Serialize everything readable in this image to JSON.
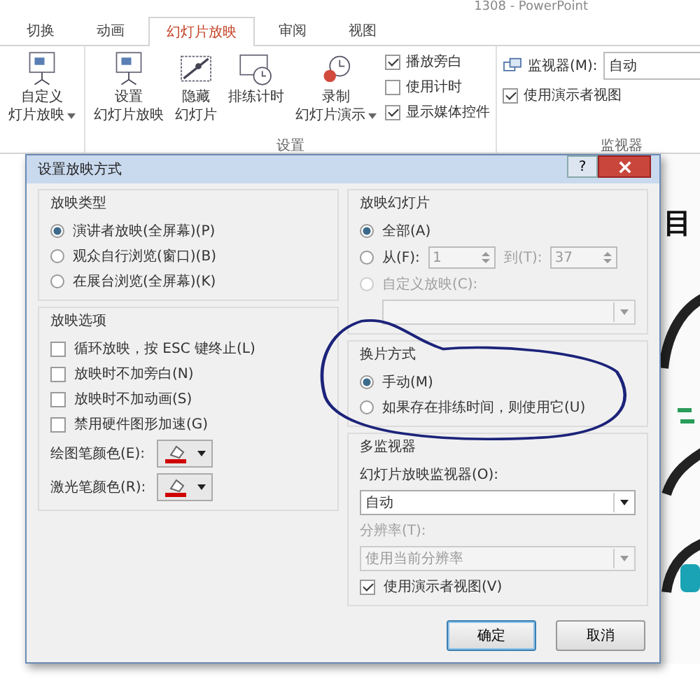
{
  "window": {
    "title": "1308 - PowerPoint"
  },
  "ribbon": {
    "tabs": [
      {
        "label": "切换",
        "selected": false
      },
      {
        "label": "动画",
        "selected": false
      },
      {
        "label": "幻灯片放映",
        "selected": true
      },
      {
        "label": "审阅",
        "selected": false
      },
      {
        "label": "视图",
        "selected": false
      }
    ],
    "groups": [
      {
        "buttons": [
          {
            "kind": "custom",
            "lines": [
              "自定义",
              "灯片放映"
            ],
            "dropdown": true
          }
        ]
      },
      {
        "label": "设置",
        "buttons": [
          {
            "kind": "setup",
            "lines": [
              "设置",
              "幻灯片放映"
            ],
            "dropdown": false
          },
          {
            "kind": "hide",
            "lines": [
              "隐藏",
              "幻灯片"
            ],
            "dropdown": false
          },
          {
            "kind": "rehearse",
            "lines": [
              "排练计时"
            ],
            "dropdown": false
          },
          {
            "kind": "record",
            "lines": [
              "录制",
              "幻灯片演示"
            ],
            "dropdown": true
          }
        ],
        "checkboxes": [
          {
            "label": "播放旁白",
            "checked": true
          },
          {
            "label": "使用计时",
            "checked": false
          },
          {
            "label": "显示媒体控件",
            "checked": true
          }
        ]
      },
      {
        "label": "监视器",
        "monitor_label": "监视器(M):",
        "monitor_value": "自动",
        "checkboxes": [
          {
            "label": "使用演示者视图",
            "checked": true
          }
        ]
      }
    ]
  },
  "dialog": {
    "title": "设置放映方式",
    "help": "?",
    "show_type": {
      "title": "放映类型",
      "options": [
        {
          "label": "演讲者放映(全屏幕)(P)",
          "selected": true
        },
        {
          "label": "观众自行浏览(窗口)(B)",
          "selected": false
        },
        {
          "label": "在展台浏览(全屏幕)(K)",
          "selected": false
        }
      ]
    },
    "show_options": {
      "title": "放映选项",
      "checkboxes": [
        {
          "label": "循环放映，按 ESC 键终止(L)",
          "checked": false
        },
        {
          "label": "放映时不加旁白(N)",
          "checked": false
        },
        {
          "label": "放映时不加动画(S)",
          "checked": false
        },
        {
          "label": "禁用硬件图形加速(G)",
          "checked": false
        }
      ],
      "pens": [
        {
          "label": "绘图笔颜色(E):"
        },
        {
          "label": "激光笔颜色(R):"
        }
      ]
    },
    "show_slides": {
      "title": "放映幻灯片",
      "all": {
        "label": "全部(A)",
        "selected": true
      },
      "range": {
        "label": "从(F):",
        "selected": false,
        "from": "1",
        "to_label": "到(T):",
        "to": "37",
        "disabled": true
      },
      "custom": {
        "label": "自定义放映(C):",
        "selected": false,
        "disabled": true
      }
    },
    "advance": {
      "title": "换片方式",
      "options": [
        {
          "label": "手动(M)",
          "selected": true
        },
        {
          "label": "如果存在排练时间，则使用它(U)",
          "selected": false
        }
      ]
    },
    "monitors": {
      "title": "多监视器",
      "monitor_label": "幻灯片放映监视器(O):",
      "monitor_value": "自动",
      "resolution_label": "分辨率(T):",
      "resolution_value": "使用当前分辨率",
      "resolution_disabled": true,
      "presenter": {
        "label": "使用演示者视图(V)",
        "checked": true
      }
    },
    "buttons": [
      {
        "label": "确定",
        "default": true
      },
      {
        "label": "取消",
        "default": false
      }
    ]
  },
  "slide": {
    "text": "目"
  }
}
